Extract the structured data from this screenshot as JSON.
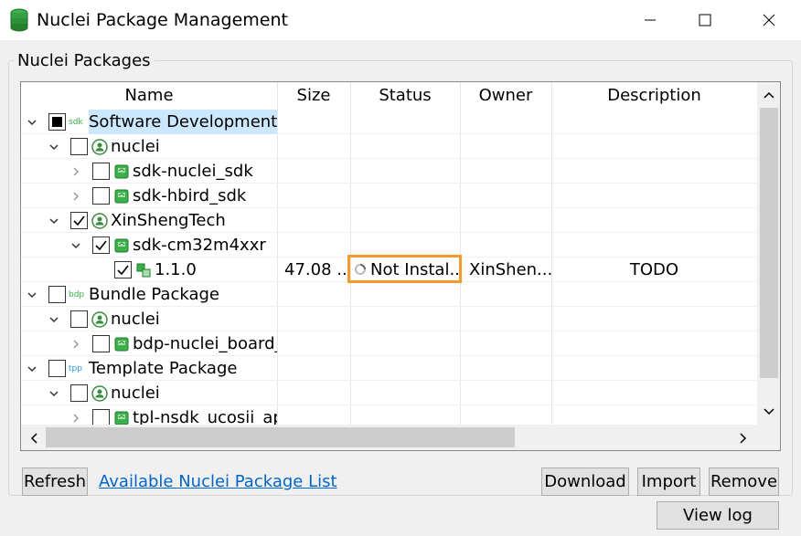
{
  "window": {
    "title": "Nuclei Package Management",
    "minimize_glyph": "—",
    "maximize_glyph": "☐",
    "close_glyph": "✕"
  },
  "group": {
    "label": "Nuclei Packages"
  },
  "columns": {
    "name": "Name",
    "size": "Size",
    "status": "Status",
    "owner": "Owner",
    "description": "Description"
  },
  "rows": [
    {
      "label": "Software Development K",
      "badge": "sdk",
      "level": 0,
      "expanded": true,
      "check": "partial",
      "icon": "category-icon",
      "selected": true
    },
    {
      "label": "nuclei",
      "level": 1,
      "expanded": true,
      "check": "unchecked",
      "icon": "user-icon"
    },
    {
      "label": "sdk-nuclei_sdk",
      "level": 2,
      "expanded": false,
      "check": "unchecked",
      "icon": "package-icon"
    },
    {
      "label": "sdk-hbird_sdk",
      "level": 2,
      "expanded": false,
      "check": "unchecked",
      "icon": "package-icon"
    },
    {
      "label": "XinShengTech",
      "level": 1,
      "expanded": true,
      "check": "checked",
      "icon": "user-icon"
    },
    {
      "label": "sdk-cm32m4xxr",
      "level": 2,
      "expanded": true,
      "check": "checked",
      "icon": "package-icon"
    },
    {
      "label": "1.1.0",
      "level": 3,
      "expanded": null,
      "check": "checked",
      "icon": "version-icon",
      "size": "47.08 ...",
      "status": "Not Instal...",
      "owner": "XinShen...",
      "description": "TODO"
    },
    {
      "label": "Bundle Package",
      "badge": "bdp",
      "level": 0,
      "expanded": true,
      "check": "unchecked",
      "icon": "category-icon"
    },
    {
      "label": "nuclei",
      "level": 1,
      "expanded": true,
      "check": "unchecked",
      "icon": "user-icon"
    },
    {
      "label": "bdp-nuclei_board_",
      "level": 2,
      "expanded": false,
      "check": "unchecked",
      "icon": "package-icon"
    },
    {
      "label": "Template Package",
      "badge": "tpp",
      "level": 0,
      "expanded": true,
      "check": "unchecked",
      "icon": "category-icon"
    },
    {
      "label": "nuclei",
      "level": 1,
      "expanded": true,
      "check": "unchecked",
      "icon": "user-icon"
    },
    {
      "label": "tpl-nsdk_ucosii_ap",
      "level": 2,
      "expanded": false,
      "check": "unchecked",
      "icon": "package-icon"
    }
  ],
  "buttons": {
    "refresh": "Refresh",
    "link": "Available Nuclei Package List",
    "download": "Download",
    "import": "Import",
    "remove": "Remove",
    "view_log": "View log"
  },
  "colors": {
    "accent_green": "#3cb04a",
    "selection": "#cce8ff",
    "highlight": "#f39a2d",
    "link": "#0066cc",
    "badge_sdk": "#3cb04a",
    "badge_bdp": "#3cb04a",
    "badge_tpp": "#2b9bd6"
  }
}
